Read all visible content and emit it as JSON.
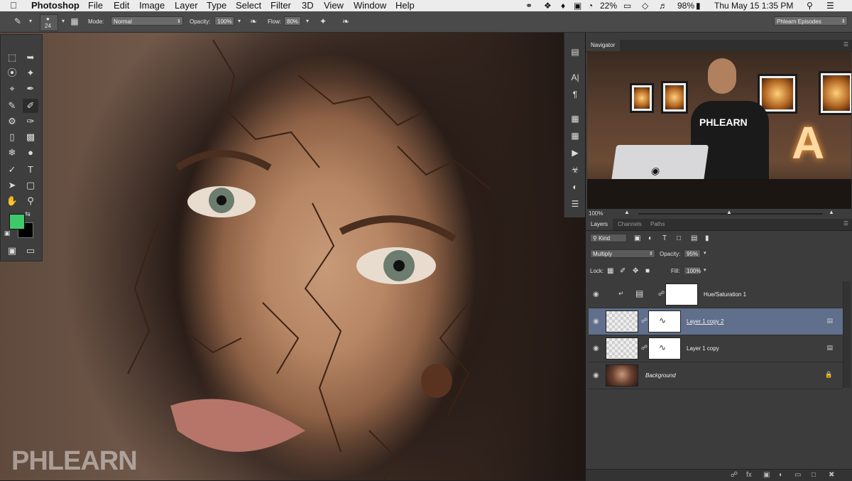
{
  "menubar": {
    "apple_icon": "apple-logo",
    "app_name": "Photoshop",
    "menus": [
      "File",
      "Edit",
      "Image",
      "Layer",
      "Type",
      "Select",
      "Filter",
      "3D",
      "View",
      "Window",
      "Help"
    ],
    "battery_small": "22%",
    "battery": "98%",
    "datetime": "Thu May 15  1:35 PM"
  },
  "options": {
    "brush_size": "24",
    "mode_label": "Mode:",
    "mode_value": "Normal",
    "opacity_label": "Opacity:",
    "opacity_value": "100%",
    "flow_label": "Flow:",
    "flow_value": "80%",
    "workspace": "Phlearn Episodes"
  },
  "toolbox": {
    "foreground_color": "#3fc96a",
    "background_color": "#000000"
  },
  "watermark": "PHLEARN",
  "navigator": {
    "tab": "Navigator",
    "zoom": "100%",
    "shirt_text": "PHLEARN",
    "letter": "A"
  },
  "layers_panel": {
    "tabs": [
      "Layers",
      "Channels",
      "Paths"
    ],
    "filter_label": "Kind",
    "blend_mode": "Multiply",
    "opacity_label": "Opacity:",
    "opacity_value": "95%",
    "lock_label": "Lock:",
    "fill_label": "Fill:",
    "fill_value": "100%",
    "layers": [
      {
        "name": "Hue/Saturation 1"
      },
      {
        "name": "Layer 1 copy 2"
      },
      {
        "name": "Layer 1 copy"
      },
      {
        "name": "Background"
      }
    ]
  },
  "colors": {
    "selection": "#5f6f8c",
    "panel_bg": "#3c3c3c",
    "accent_green": "#3fc96a"
  }
}
